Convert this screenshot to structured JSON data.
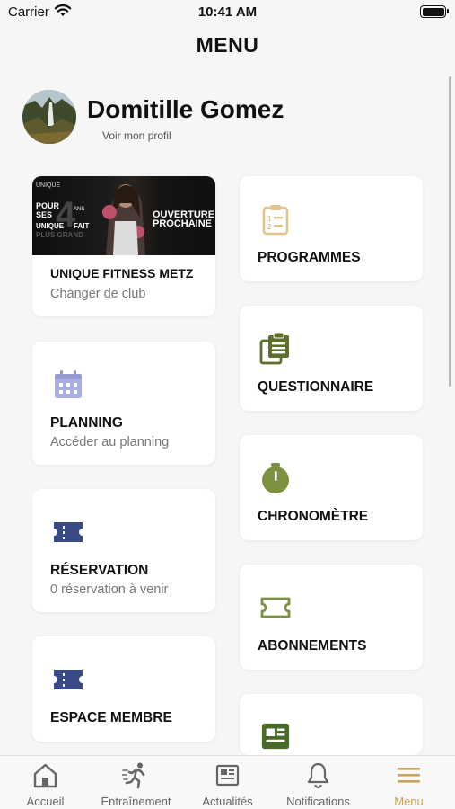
{
  "status_bar": {
    "carrier": "Carrier",
    "time": "10:41 AM"
  },
  "page_title": "MENU",
  "profile": {
    "name": "Domitille Gomez",
    "link": "Voir mon profil"
  },
  "club": {
    "banner": {
      "brand": "UNIQUE",
      "line1": "POUR",
      "line2": "SES",
      "big_number": "4",
      "line3": "ANS",
      "line4": "UNIQUE",
      "line5": "FAIT",
      "line6": "PLUS GRAND",
      "right1": "OUVERTURE",
      "right2": "PROCHAINE"
    },
    "title": "UNIQUE FITNESS METZ",
    "subtitle": "Changer de club"
  },
  "left_cards": [
    {
      "title": "PLANNING",
      "subtitle": "Accéder au planning",
      "icon": "calendar-icon"
    },
    {
      "title": "RÉSERVATION",
      "subtitle": "0 réservation à venir",
      "icon": "ticket-icon"
    },
    {
      "title": "ESPACE MEMBRE",
      "icon": "ticket-icon"
    }
  ],
  "right_cards": [
    {
      "title": "PROGRAMMES",
      "icon": "clipboard-list-icon"
    },
    {
      "title": "QUESTIONNAIRE",
      "icon": "clipboard-copy-icon"
    },
    {
      "title": "CHRONOMÈTRE",
      "icon": "stopwatch-icon"
    },
    {
      "title": "ABONNEMENTS",
      "icon": "ticket-outline-icon"
    },
    {
      "title": "",
      "icon": "news-icon"
    }
  ],
  "tabs": [
    {
      "label": "Accueil",
      "icon": "home-icon"
    },
    {
      "label": "Entraînement",
      "icon": "running-icon"
    },
    {
      "label": "Actualités",
      "icon": "newspaper-icon"
    },
    {
      "label": "Notifications",
      "icon": "bell-icon"
    },
    {
      "label": "Menu",
      "icon": "menu-icon",
      "active": true
    }
  ],
  "colors": {
    "accent": "#c9a45c",
    "gold_icon": "#e0c48a",
    "olive_icon": "#5f6e2a",
    "green_icon": "#7d9240",
    "navy_icon": "#3a4a86",
    "lavender_icon": "#a9aee0"
  }
}
